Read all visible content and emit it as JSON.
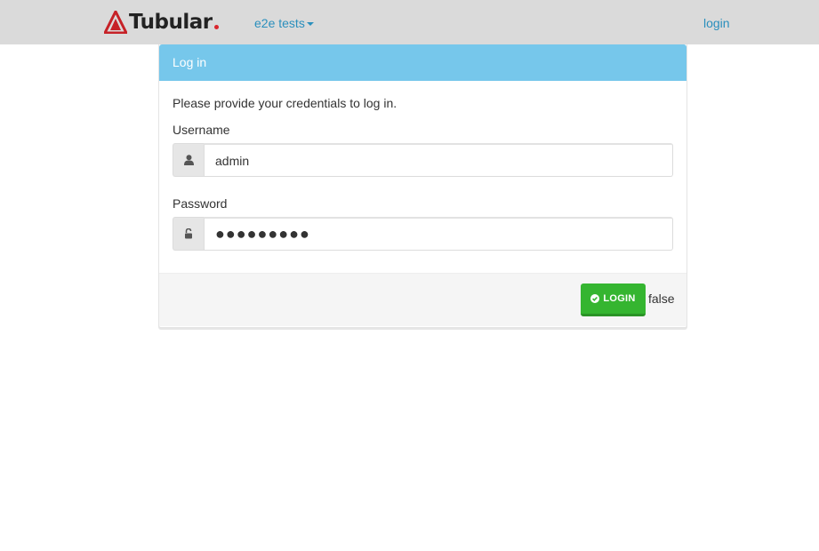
{
  "navbar": {
    "brand_name": "Tubular",
    "dropdown_label": "e2e tests",
    "login_link": "login"
  },
  "panel": {
    "heading": "Log in",
    "intro": "Please provide your credentials to log in.",
    "username_label": "Username",
    "username_value": "admin",
    "password_label": "Password",
    "password_value": "●●●●●●●●●",
    "login_button": "LOGIN",
    "result_text": "false"
  },
  "icons": {
    "user": "user-icon",
    "lock": "unlock-icon",
    "check": "check-circle-icon"
  },
  "colors": {
    "navbar_bg": "#dadada",
    "link": "#2a8fbd",
    "panel_heading_bg": "#76c7eb",
    "login_button_bg": "#35b530",
    "brand_accent": "#d9262d"
  }
}
